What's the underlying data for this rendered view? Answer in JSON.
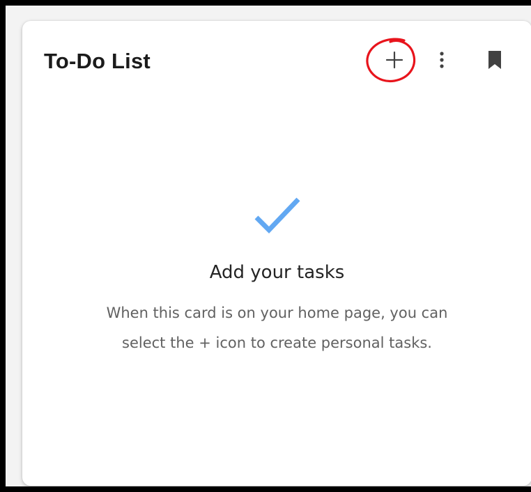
{
  "card": {
    "title": "To-Do List",
    "header_actions": [
      {
        "name": "add",
        "icon": "plus-icon",
        "annotated": true,
        "annotation_color": "#e8141c"
      },
      {
        "name": "more-options",
        "icon": "more-vertical-icon"
      },
      {
        "name": "bookmark",
        "icon": "bookmark-icon"
      }
    ],
    "empty_state": {
      "icon": "checkmark-icon",
      "icon_color": "#62a8f2",
      "heading": "Add your tasks",
      "body": "When this card is on your home page, you can select the + icon to create personal tasks."
    }
  },
  "colors": {
    "outer_border": "#000000",
    "card_background": "#ffffff",
    "title_text": "#1b1b1b",
    "icon_gray": "#616161",
    "body_text": "#616161"
  }
}
